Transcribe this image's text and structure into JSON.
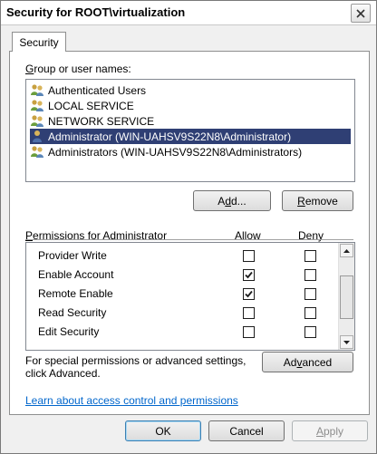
{
  "window": {
    "title": "Security for ROOT\\virtualization"
  },
  "tab": {
    "label": "Security"
  },
  "group_section": {
    "label_prefix": "",
    "label_hotkey": "G",
    "label_rest": "roup or user names:",
    "items": [
      {
        "label": "Authenticated Users",
        "icon": "users-group-icon",
        "selected": false
      },
      {
        "label": "LOCAL SERVICE",
        "icon": "users-group-icon",
        "selected": false
      },
      {
        "label": "NETWORK SERVICE",
        "icon": "users-group-icon",
        "selected": false
      },
      {
        "label": "Administrator (WIN-UAHSV9S22N8\\Administrator)",
        "icon": "user-icon",
        "selected": true
      },
      {
        "label": "Administrators (WIN-UAHSV9S22N8\\Administrators)",
        "icon": "users-group-icon",
        "selected": false
      }
    ]
  },
  "buttons": {
    "add_pre": "A",
    "add_hotkey": "d",
    "add_post": "d...",
    "remove_hotkey": "R",
    "remove_post": "emove",
    "advanced_pre": "Ad",
    "advanced_hotkey": "v",
    "advanced_post": "anced",
    "ok": "OK",
    "cancel": "Cancel",
    "apply_hotkey": "A",
    "apply_post": "pply"
  },
  "permissions": {
    "label_hotkey": "P",
    "label_rest": "ermissions for Administrator",
    "allow_header": "Allow",
    "deny_header": "Deny",
    "rows": [
      {
        "name": "Provider Write",
        "allow": false,
        "deny": false
      },
      {
        "name": "Enable Account",
        "allow": true,
        "deny": false
      },
      {
        "name": "Remote Enable",
        "allow": true,
        "deny": false
      },
      {
        "name": "Read Security",
        "allow": false,
        "deny": false
      },
      {
        "name": "Edit Security",
        "allow": false,
        "deny": false
      }
    ]
  },
  "special_text_line1": "For special permissions or advanced settings,",
  "special_text_line2": "click Advanced.",
  "learn_link": "Learn about access control and permissions"
}
